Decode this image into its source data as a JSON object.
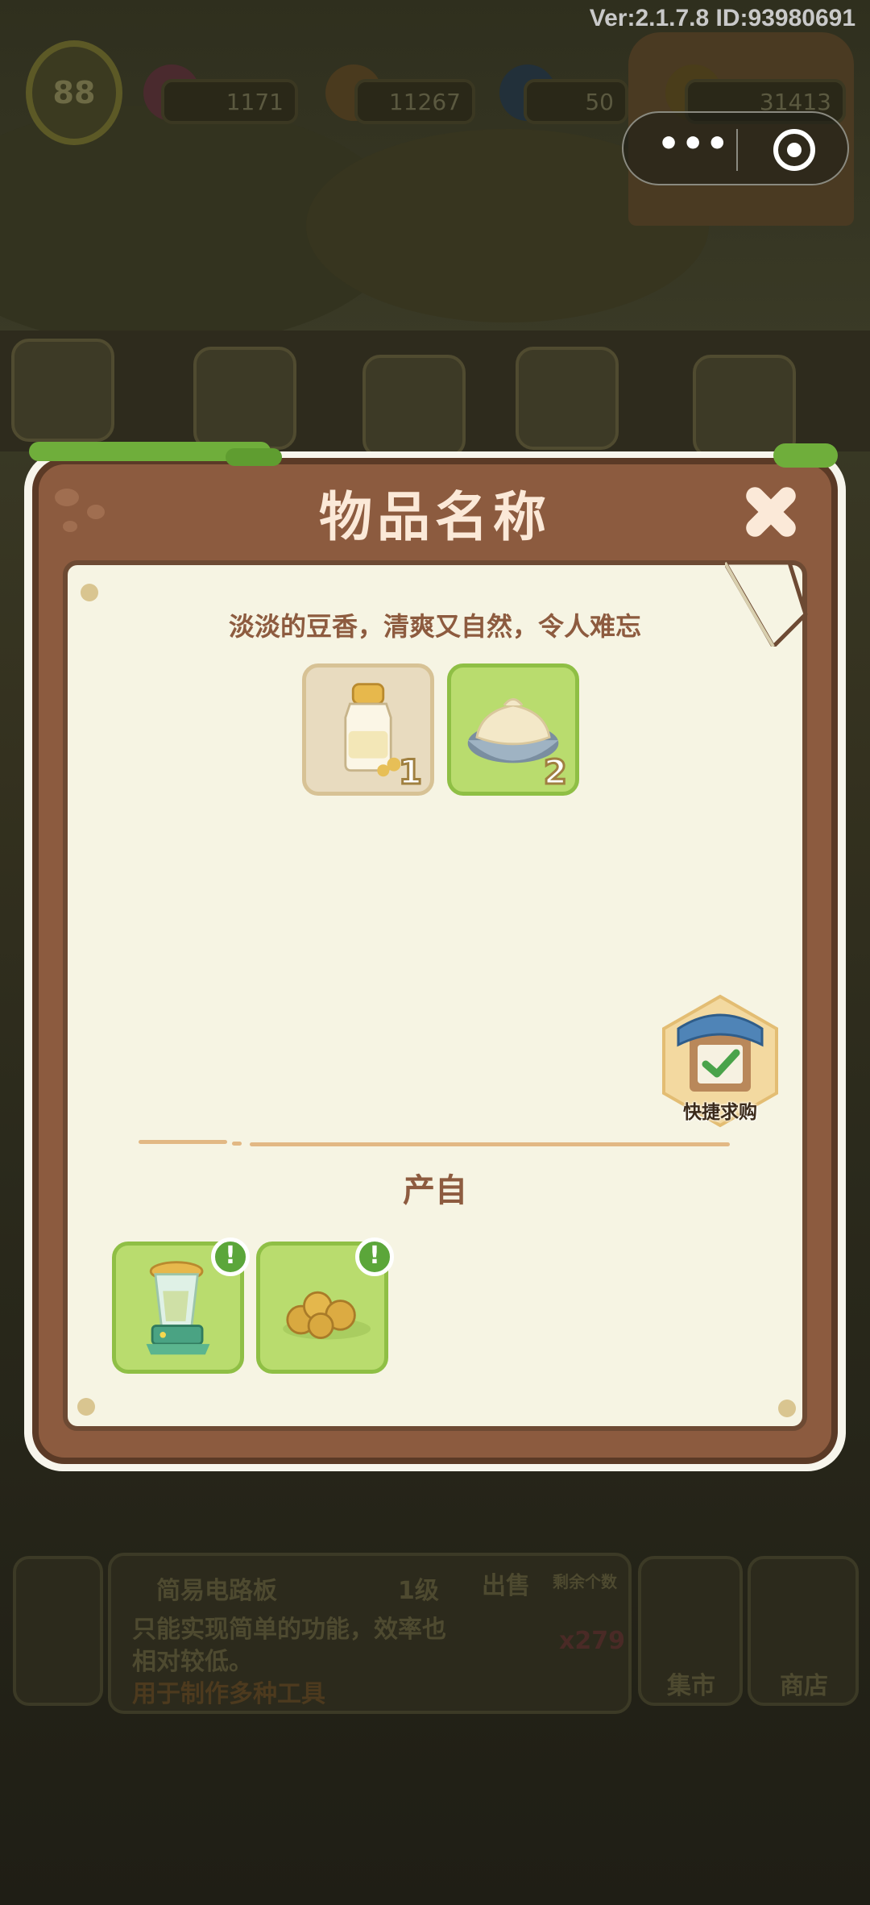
{
  "hud": {
    "version_text": "Ver:2.1.7.8 ID:93980691",
    "level": "88",
    "gems": "1171",
    "carrots": "11267",
    "energy": "50",
    "coins": "31413"
  },
  "bottom_panel": {
    "item_name": "简易电路板",
    "item_level": "1级",
    "description_line1": "只能实现简单的功能，效率也",
    "description_line2": "相对较低。",
    "usage": "用于制作多种工具",
    "sell_label": "出售",
    "remaining_label": "剩余个数",
    "remaining_value": "x279",
    "market_label": "集市",
    "shop_label": "商店"
  },
  "modal": {
    "title": "物品名称",
    "description": "淡淡的豆香，清爽又自然，令人难忘",
    "ingredients": [
      {
        "name": "soy-milk-bottle",
        "count": "1"
      },
      {
        "name": "cream-bowl",
        "count": "2"
      }
    ],
    "quick_buy_label": "快捷求购",
    "section_title": "产自",
    "sources": [
      {
        "name": "juicer-machine",
        "alert": "!"
      },
      {
        "name": "soybeans",
        "alert": "!"
      }
    ]
  },
  "colors": {
    "wood": "#8c5b3f",
    "paper": "#f6f4e3",
    "title_text": "#fbe9d8",
    "text_brown": "#8d5b3f",
    "slot_green": "#b9dc6e"
  }
}
